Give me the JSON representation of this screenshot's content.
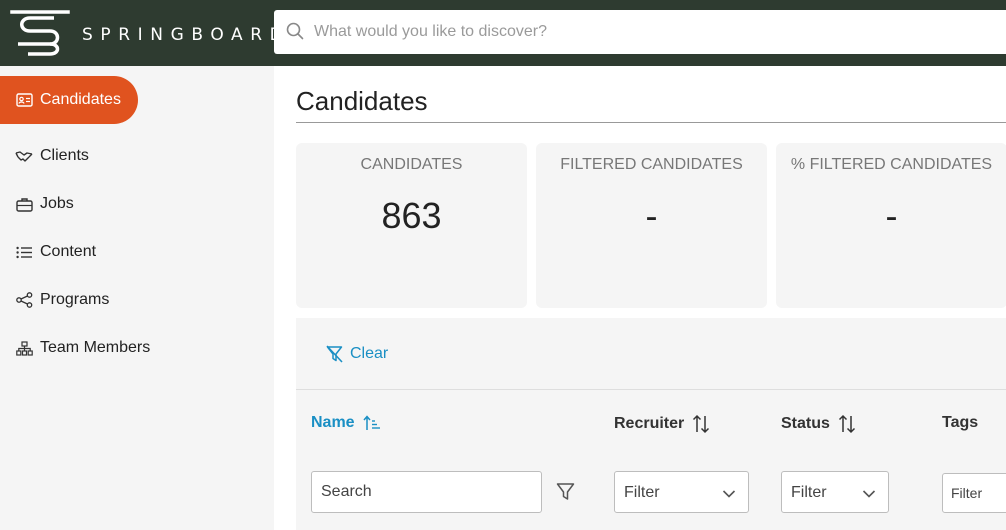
{
  "brand": {
    "name": "SPRINGBOARD"
  },
  "search": {
    "placeholder": "What would you like to discover?"
  },
  "sidebar": {
    "items": [
      {
        "label": "Candidates",
        "icon": "id-card-icon",
        "active": true
      },
      {
        "label": "Clients",
        "icon": "handshake-icon",
        "active": false
      },
      {
        "label": "Jobs",
        "icon": "briefcase-icon",
        "active": false
      },
      {
        "label": "Content",
        "icon": "list-icon",
        "active": false
      },
      {
        "label": "Programs",
        "icon": "share-nodes-icon",
        "active": false
      },
      {
        "label": "Team Members",
        "icon": "org-chart-icon",
        "active": false
      }
    ]
  },
  "page": {
    "title": "Candidates"
  },
  "stats": [
    {
      "label": "CANDIDATES",
      "value": "863"
    },
    {
      "label": "FILTERED CANDIDATES",
      "value": "-"
    },
    {
      "label": "% FILTERED CANDIDATES",
      "value": "-"
    }
  ],
  "filters": {
    "clear_label": "Clear",
    "columns": [
      {
        "label": "Name",
        "sorted": true
      },
      {
        "label": "Recruiter",
        "sorted": false
      },
      {
        "label": "Status",
        "sorted": false
      },
      {
        "label": "Tags",
        "sorted": false
      }
    ],
    "name_search_placeholder": "Search",
    "recruiter_filter": "Filter",
    "status_filter": "Filter",
    "tags_filter_placeholder": "Filter"
  },
  "colors": {
    "topbar": "#2e3b30",
    "accent": "#e0531f",
    "link": "#1a8fc4",
    "panel": "#f5f5f5"
  }
}
